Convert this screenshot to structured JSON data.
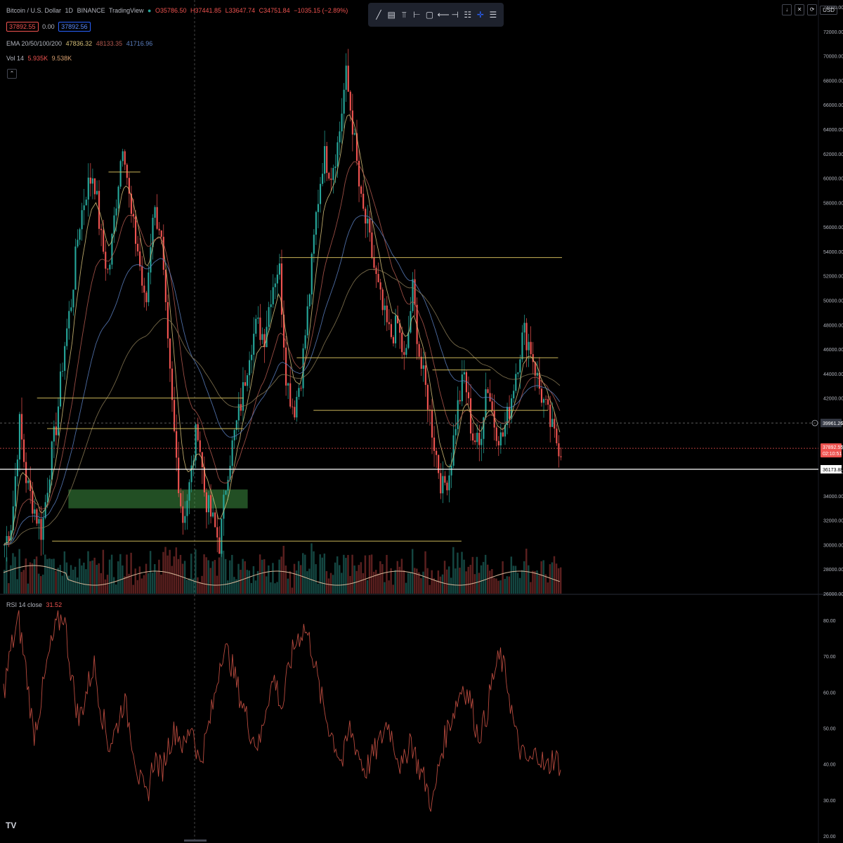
{
  "header": {
    "symbol": "Bitcoin / U.S. Dollar",
    "interval": "1D",
    "exchange": "BINANCE",
    "source": "TradingView",
    "open": "O35786.50",
    "high": "H37441.85",
    "low": "L33647.74",
    "close": "C34751.84",
    "change": "−1035.15 (−2.89%)",
    "sell_price": "37892.55",
    "spread": "0.00",
    "buy_price": "37892.56",
    "ema_label": "EMA 20/50/100/200",
    "ema_values": [
      "47836.32",
      "48133.35",
      "41716.96"
    ],
    "vol_label": "Vol 14",
    "vol_values": [
      "5.935K",
      "9.538K"
    ],
    "toggle_glyph": "⌃"
  },
  "toolbar": {
    "tools": [
      "trend-line",
      "long-position",
      "fib",
      "horizontal-ray",
      "rectangle",
      "arrow",
      "measure",
      "crosshair",
      "text-lines"
    ]
  },
  "top_right": {
    "currency": "USD"
  },
  "rsi": {
    "label": "RSI 14 close",
    "value": "31.52"
  },
  "colors": {
    "bg": "#000000",
    "up": "#26a69a",
    "down": "#ef5350",
    "hline": "#c9b458",
    "zone": "#4caf50",
    "rsi_line": "#b84a3e",
    "current_price_bg": "#ef5350",
    "level_bg": "#ffffff"
  },
  "chart_data": [
    {
      "type": "candlestick",
      "title": "",
      "ylim": [
        26000,
        74000
      ],
      "price_ticks": [
        "74000.00",
        "72000.00",
        "70000.00",
        "68000.00",
        "66000.00",
        "64000.00",
        "62000.00",
        "60000.00",
        "58000.00",
        "56000.00",
        "54000.00",
        "52000.00",
        "50000.00",
        "48000.00",
        "46000.00",
        "44000.00",
        "42000.00",
        "40000.00",
        "38000.00",
        "36000.00",
        "34000.00",
        "32000.00",
        "30000.00",
        "28000.00",
        "26000.00"
      ],
      "price_trajectory": [
        30000,
        32000,
        40000,
        35000,
        33000,
        31000,
        36000,
        40000,
        46000,
        50000,
        56000,
        59000,
        60500,
        55000,
        52000,
        58000,
        63500,
        57000,
        54000,
        49000,
        57500,
        56000,
        46000,
        38000,
        32000,
        35000,
        40000,
        34000,
        32000,
        30000,
        36000,
        39000,
        42000,
        46000,
        48000,
        47000,
        51000,
        53000,
        43500,
        41000,
        44000,
        50000,
        57000,
        62000,
        60500,
        63000,
        68500,
        64000,
        58000,
        55500,
        52000,
        49000,
        47000,
        48000,
        44500,
        51000,
        45000,
        42000,
        38000,
        34500,
        36000,
        41000,
        44000,
        39000,
        38000,
        43500,
        40000,
        38500,
        41000,
        44500,
        47500,
        46000,
        43000,
        41000,
        39000,
        37800
      ],
      "horizontal_levels": [
        {
          "price": 60500,
          "x_from": 0.188,
          "x_to": 0.245
        },
        {
          "price": 42000,
          "x_from": 0.06,
          "x_to": 0.43
        },
        {
          "price": 39500,
          "x_from": 0.078,
          "x_to": 0.43
        },
        {
          "price": 30300,
          "x_from": 0.087,
          "x_to": 0.82
        },
        {
          "price": 53500,
          "x_from": 0.495,
          "x_to": 1.0
        },
        {
          "price": 45300,
          "x_from": 0.525,
          "x_to": 0.993
        },
        {
          "price": 44300,
          "x_from": 0.768,
          "x_to": 0.872
        },
        {
          "price": 41000,
          "x_from": 0.555,
          "x_to": 0.975
        }
      ],
      "support_zone": {
        "price_low": 33000,
        "price_high": 34500,
        "x_from": 0.08,
        "x_to": 0.4
      },
      "current_price": {
        "value": 37892.55,
        "label": "37892.55",
        "countdown": "02:10:51"
      },
      "crosshair_price": {
        "value": 39961.26,
        "label": "39961.26"
      },
      "key_level": {
        "value": 36173.88,
        "label": "36173.88"
      }
    },
    {
      "type": "line",
      "title": "RSI 14 close",
      "ylim": [
        20,
        80
      ],
      "rsi_ticks": [
        "80.00",
        "70.00",
        "60.00",
        "50.00",
        "40.00",
        "30.00",
        "20.00"
      ],
      "values": [
        60,
        72,
        80,
        66,
        48,
        58,
        70,
        78,
        82,
        65,
        52,
        60,
        68,
        55,
        45,
        50,
        58,
        48,
        36,
        30,
        42,
        38,
        46,
        50,
        44,
        52,
        40,
        48,
        58,
        72,
        70,
        62,
        55,
        48,
        45,
        58,
        64,
        55,
        68,
        75,
        78,
        72,
        60,
        52,
        46,
        40,
        50,
        44,
        38,
        42,
        46,
        52,
        45,
        38,
        48,
        40,
        35,
        28,
        42,
        50,
        56,
        62,
        58,
        48,
        52,
        64,
        70,
        62,
        48,
        42,
        40,
        44,
        38,
        42,
        40
      ]
    }
  ]
}
